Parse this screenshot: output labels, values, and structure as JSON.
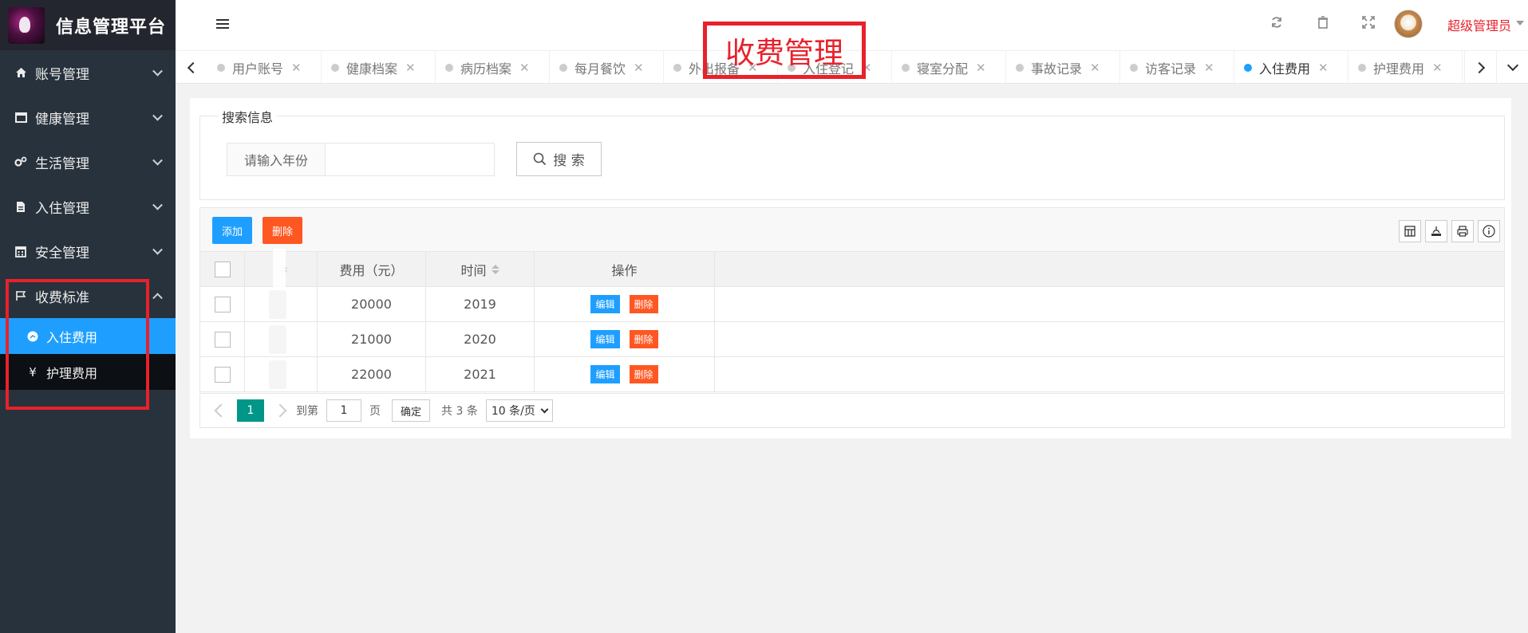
{
  "app": {
    "title": "信息管理平台"
  },
  "sidebar": {
    "items": [
      {
        "label": "账号管理",
        "icon": "home-icon"
      },
      {
        "label": "健康管理",
        "icon": "window-icon"
      },
      {
        "label": "生活管理",
        "icon": "gears-icon"
      },
      {
        "label": "入住管理",
        "icon": "document-icon"
      },
      {
        "label": "安全管理",
        "icon": "calendar-icon"
      },
      {
        "label": "收费标准",
        "icon": "flag-icon",
        "expanded": true
      }
    ],
    "sub_items": [
      {
        "label": "入住费用",
        "icon": "dashboard-icon",
        "active": true
      },
      {
        "label": "护理费用",
        "icon": "yen-icon"
      }
    ]
  },
  "header": {
    "user": "超级管理员",
    "icons": [
      "refresh-icon",
      "trash-icon",
      "fullscreen-icon"
    ]
  },
  "tabs": [
    {
      "label": "用户账号"
    },
    {
      "label": "健康档案"
    },
    {
      "label": "病历档案"
    },
    {
      "label": "每月餐饮"
    },
    {
      "label": "外出报备"
    },
    {
      "label": "入住登记"
    },
    {
      "label": "寝室分配"
    },
    {
      "label": "事故记录"
    },
    {
      "label": "访客记录"
    },
    {
      "label": "入住费用",
      "active": true
    },
    {
      "label": "护理费用"
    }
  ],
  "overlay_title": "收费管理",
  "search": {
    "legend": "搜索信息",
    "label": "请输入年份",
    "value": "",
    "button": "搜 索"
  },
  "toolbar": {
    "add": "添加",
    "delete": "删除"
  },
  "table": {
    "columns": [
      "",
      "",
      "费用（元）",
      "时间",
      "操作"
    ],
    "rows": [
      {
        "fee": "20000",
        "time": "2019"
      },
      {
        "fee": "21000",
        "time": "2020"
      },
      {
        "fee": "22000",
        "time": "2021"
      }
    ],
    "edit_label": "编辑",
    "delete_label": "删除"
  },
  "pager": {
    "current": "1",
    "goto": "到第",
    "page_value": "1",
    "page_suffix": "页",
    "confirm": "确定",
    "total": "共 3 条",
    "per_page": "10 条/页"
  },
  "colors": {
    "accent": "#1e9fff",
    "danger": "#ff5722",
    "highlight": "#e8212b",
    "pager": "#009688",
    "sidebar": "#28323c"
  }
}
